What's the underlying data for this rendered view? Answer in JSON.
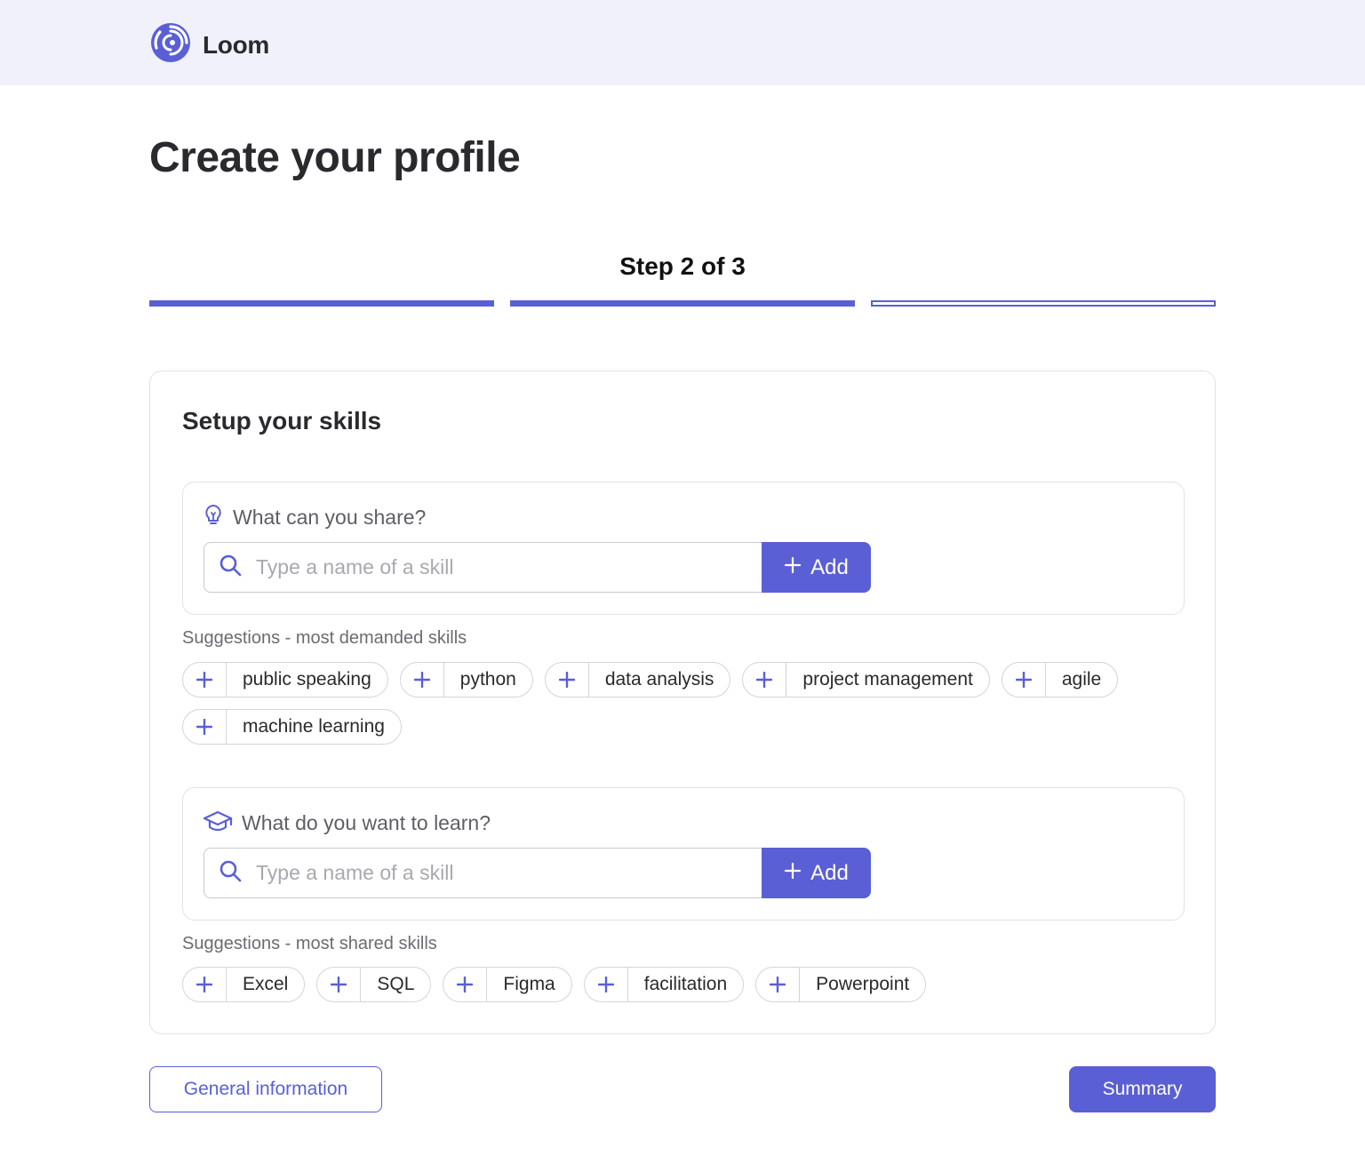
{
  "app": {
    "name": "Loom"
  },
  "page": {
    "title": "Create your profile"
  },
  "steps": {
    "label": "Step 2 of 3",
    "current": 2,
    "total": 3
  },
  "card": {
    "title": "Setup your skills"
  },
  "share": {
    "question": "What can you share?",
    "placeholder": "Type a name of a skill",
    "add_label": "Add",
    "suggestions_label": "Suggestions - most demanded skills",
    "suggestions": [
      "public speaking",
      "python",
      "data analysis",
      "project management",
      "agile",
      "machine learning"
    ]
  },
  "learn": {
    "question": "What do you want to learn?",
    "placeholder": "Type a name of a skill",
    "add_label": "Add",
    "suggestions_label": "Suggestions - most shared skills",
    "suggestions": [
      "Excel",
      "SQL",
      "Figma",
      "facilitation",
      "Powerpoint"
    ]
  },
  "footer": {
    "back_label": "General information",
    "next_label": "Summary"
  },
  "colors": {
    "accent": "#5a5fd6",
    "topbar": "#f0f1fa",
    "text": "#2a2a2e"
  },
  "icons": {
    "logo": "loom-swirl-logo",
    "share": "lightbulb-icon",
    "learn": "graduation-cap-icon",
    "search": "search-icon",
    "add": "plus-icon"
  }
}
